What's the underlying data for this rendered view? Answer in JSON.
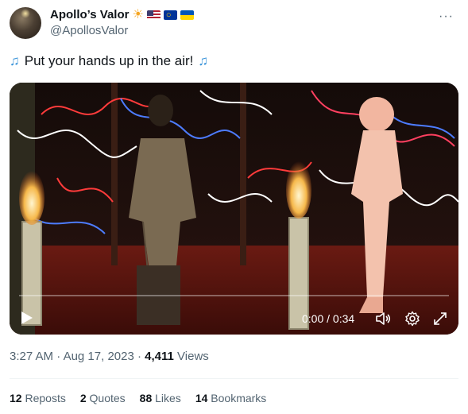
{
  "author": {
    "display_name": "Apollo’s Valor",
    "handle": "@ApollosValor",
    "emoji_badges": [
      "sun",
      "us-flag",
      "eu-flag",
      "ukraine-flag"
    ]
  },
  "tweet": {
    "text": "Put your hands up in the air!",
    "leading_emoji": "music-notes",
    "trailing_emoji": "music-notes"
  },
  "video": {
    "time_display": "0:00 / 0:34",
    "progress": 0.0
  },
  "meta": {
    "time": "3:27 AM",
    "date": "Aug 17, 2023",
    "views_count": "4,411",
    "views_label": "Views"
  },
  "stats": {
    "reposts_count": "12",
    "reposts_label": "Reposts",
    "quotes_count": "2",
    "quotes_label": "Quotes",
    "likes_count": "88",
    "likes_label": "Likes",
    "bookmarks_count": "14",
    "bookmarks_label": "Bookmarks"
  },
  "colors": {
    "accent": "#1d9bf0",
    "secondary_text": "#536471",
    "primary_text": "#0f1419"
  }
}
